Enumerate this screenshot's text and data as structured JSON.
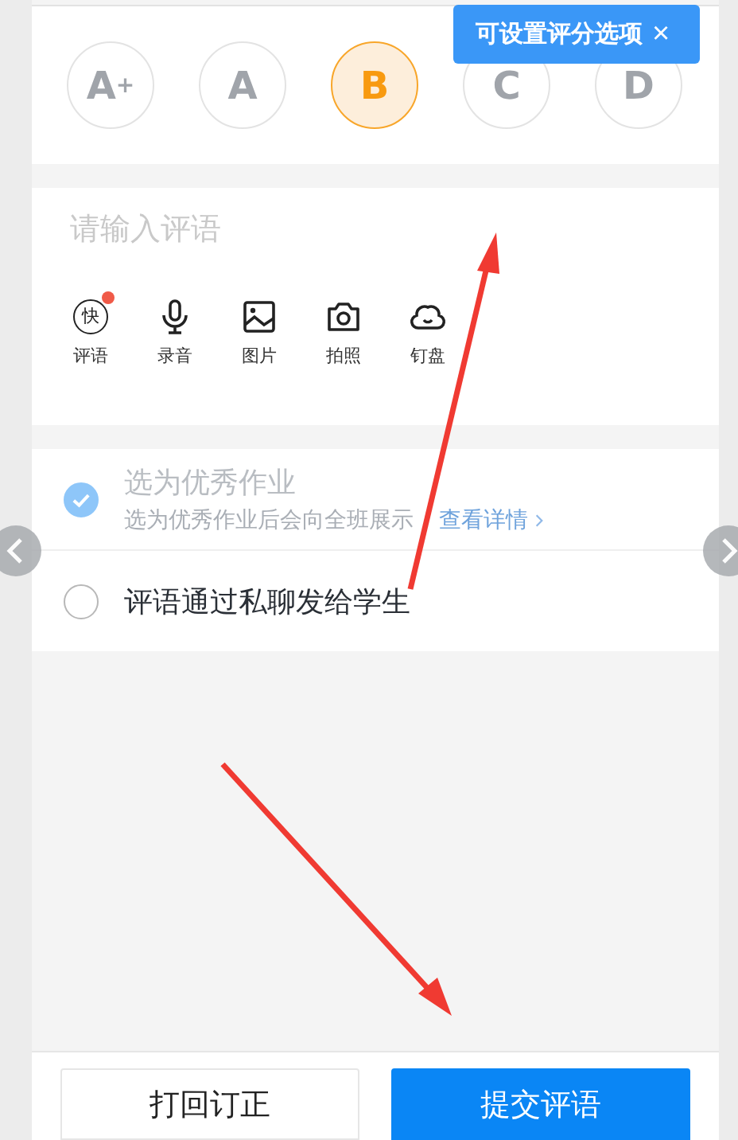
{
  "grades": [
    {
      "label": "A$^{+}$",
      "selected": false
    },
    {
      "label": "A",
      "selected": false
    },
    {
      "label": "B",
      "selected": true
    },
    {
      "label": "C",
      "selected": false
    },
    {
      "label": "D",
      "selected": false
    }
  ],
  "tooltip": {
    "text": "可设置评分选项",
    "close": "×"
  },
  "comment": {
    "placeholder": "请输入评语"
  },
  "tools": [
    {
      "kind": "quick",
      "icon_text": "快",
      "label": "评语",
      "badge": true
    },
    {
      "kind": "mic",
      "label": "录音",
      "badge": false
    },
    {
      "kind": "image",
      "label": "图片",
      "badge": false
    },
    {
      "kind": "camera",
      "label": "拍照",
      "badge": false
    },
    {
      "kind": "cloud",
      "label": "钉盘",
      "badge": false
    }
  ],
  "options": [
    {
      "title": "选为优秀作业",
      "subtitle": "选为优秀作业后会向全班展示",
      "link": "查看详情",
      "checked": true,
      "disabled": true
    },
    {
      "title": "评语通过私聊发给学生",
      "checked": false,
      "disabled": false
    }
  ],
  "buttons": [
    {
      "label": "打回订正",
      "primary": false
    },
    {
      "label": "提交评语",
      "primary": true
    }
  ]
}
